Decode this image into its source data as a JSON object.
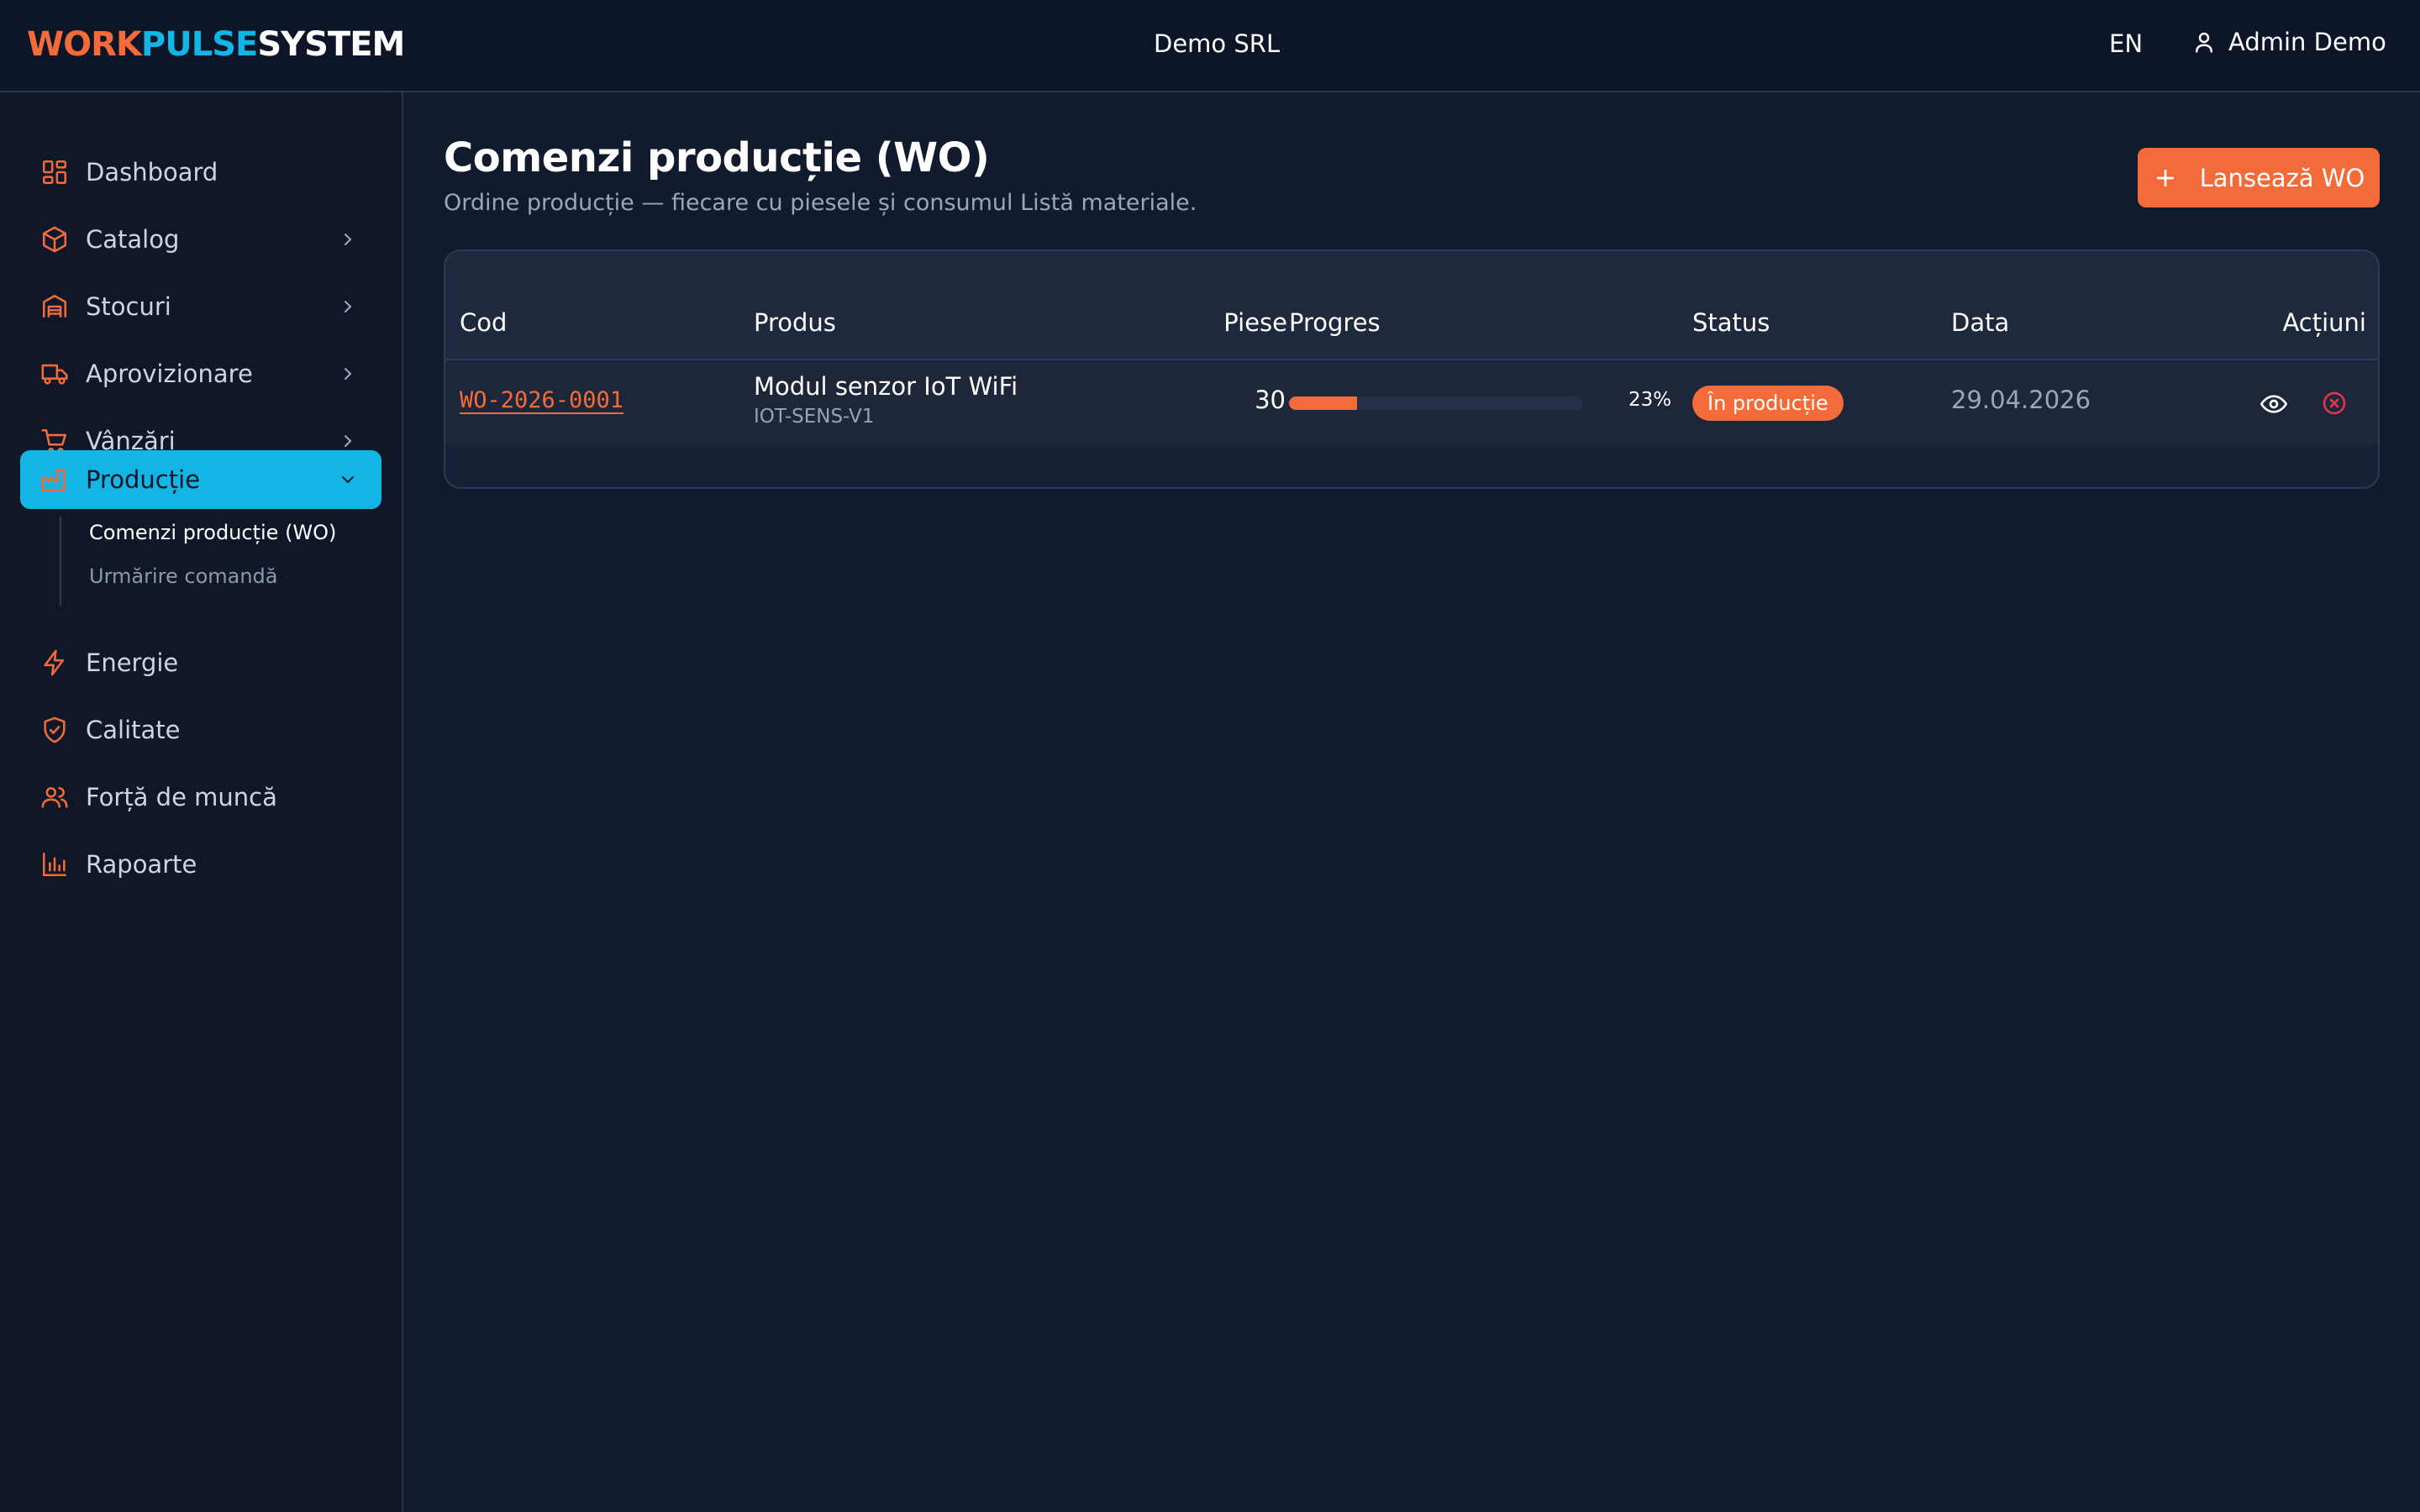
{
  "header": {
    "logo": {
      "part1": "WORK",
      "part2": "PULSE",
      "part3": "SYSTEM"
    },
    "company": "Demo SRL",
    "language": "EN",
    "user": "Admin Demo"
  },
  "sidebar": {
    "items": [
      {
        "label": "Dashboard",
        "icon": "dashboard-icon"
      },
      {
        "label": "Catalog",
        "icon": "box-icon",
        "expandable": true
      },
      {
        "label": "Stocuri",
        "icon": "warehouse-icon",
        "expandable": true
      },
      {
        "label": "Aprovizionare",
        "icon": "truck-icon",
        "expandable": true
      },
      {
        "label": "Vânzări",
        "icon": "cart-icon",
        "expandable": true
      },
      {
        "label": "Producție",
        "icon": "factory-icon",
        "expandable": true,
        "active": true
      },
      {
        "label": "Energie",
        "icon": "lightning-icon"
      },
      {
        "label": "Calitate",
        "icon": "shield-check-icon"
      },
      {
        "label": "Forță de muncă",
        "icon": "users-icon"
      },
      {
        "label": "Rapoarte",
        "icon": "bar-chart-icon"
      }
    ],
    "subitems": [
      {
        "label": "Comenzi producție (WO)",
        "active": true
      },
      {
        "label": "Urmărire comandă",
        "active": false
      }
    ]
  },
  "main": {
    "title": "Comenzi producție (WO)",
    "subtitle": "Ordine producție — fiecare cu piesele și consumul Listă materiale.",
    "launch_button": "Lansează WO",
    "table": {
      "columns": [
        "Cod",
        "Produs",
        "Piese",
        "Progres",
        "Status",
        "Data",
        "Acțiuni"
      ],
      "rows": [
        {
          "code": "WO-2026-0001",
          "product": "Modul senzor IoT WiFi",
          "sku": "IOT-SENS-V1",
          "pieces": "30",
          "progress": 0.23,
          "progress_label": "23%",
          "status": "În producție",
          "date": "29.04.2026"
        }
      ]
    }
  },
  "colors": {
    "accent": "#f26b38",
    "brand_blue": "#12b5e3",
    "background": "#121b2e",
    "danger": "#e0344a"
  }
}
